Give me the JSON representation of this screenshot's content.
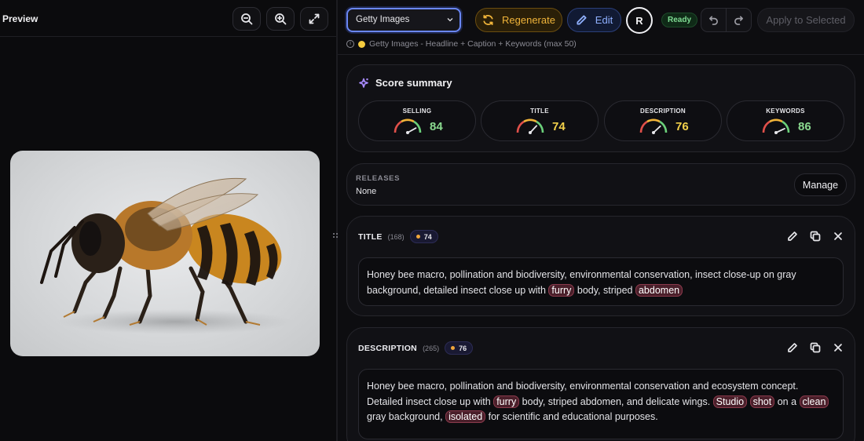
{
  "preview": {
    "title": "Preview"
  },
  "toolbar": {
    "preset": "Getty Images",
    "regenerate_label": "Regenerate",
    "edit_label": "Edit",
    "avatar_initial": "R",
    "status": "Ready",
    "apply_label": "Apply to Selected",
    "preset_hint": "Getty Images - Headline + Caption + Keywords (max 50)"
  },
  "score_summary": {
    "title": "Score summary",
    "scores": [
      {
        "label": "SELLING",
        "value": "84",
        "color": "#8ad98f"
      },
      {
        "label": "TITLE",
        "value": "74",
        "color": "#f2d04a"
      },
      {
        "label": "DESCRIPTION",
        "value": "76",
        "color": "#f2d04a"
      },
      {
        "label": "KEYWORDS",
        "value": "86",
        "color": "#8ad98f"
      }
    ]
  },
  "releases": {
    "label": "RELEASES",
    "value": "None",
    "manage_label": "Manage"
  },
  "title_field": {
    "name": "TITLE",
    "count": "(168)",
    "score": "74",
    "segments": [
      {
        "t": "Honey bee macro, pollination and biodiversity, environmental conservation, insect close-up on gray background, detailed insect close up with "
      },
      {
        "t": "furry",
        "hl": true
      },
      {
        "t": " body, striped "
      },
      {
        "t": "abdomen",
        "hl": true
      }
    ]
  },
  "description_field": {
    "name": "DESCRIPTION",
    "count": "(265)",
    "score": "76",
    "segments": [
      {
        "t": "Honey bee macro, pollination and biodiversity, environmental conservation and ecosystem concept. Detailed insect close up with "
      },
      {
        "t": "furry",
        "hl": true
      },
      {
        "t": " body, striped abdomen, and delicate wings. "
      },
      {
        "t": "Studio",
        "hl": true
      },
      {
        "t": " "
      },
      {
        "t": "shot",
        "hl": true
      },
      {
        "t": " on a "
      },
      {
        "t": "clean",
        "hl": true
      },
      {
        "t": " gray background, "
      },
      {
        "t": "isolated",
        "hl": true
      },
      {
        "t": " for scientific and educational purposes."
      }
    ]
  },
  "icons": {
    "zoom_out": "zoom-out-icon",
    "zoom_in": "zoom-in-icon",
    "expand": "expand-icon",
    "sparkle": "sparkle-icon",
    "edit": "pencil-icon",
    "copy": "copy-icon",
    "close": "close-icon",
    "undo": "undo-icon",
    "redo": "redo-icon"
  }
}
